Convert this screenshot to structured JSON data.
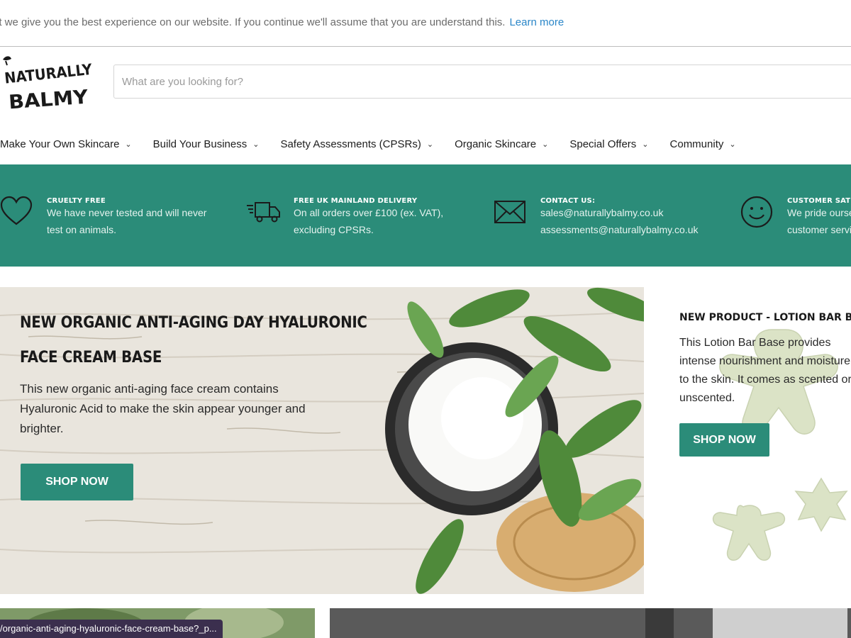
{
  "cookie": {
    "text": "at we give you the best experience on our website. If you continue we'll assume that you are understand this.",
    "link": "Learn more"
  },
  "logo": {
    "line1": "NATURALLY",
    "line2": "BALMY"
  },
  "search": {
    "placeholder": "What are you looking for?"
  },
  "nav": {
    "items": [
      {
        "label": "Make Your Own Skincare"
      },
      {
        "label": "Build Your Business"
      },
      {
        "label": "Safety Assessments (CPSRs)"
      },
      {
        "label": "Organic Skincare"
      },
      {
        "label": "Special Offers"
      },
      {
        "label": "Community"
      }
    ]
  },
  "features": [
    {
      "icon": "heart-icon",
      "title": "CRUELTY FREE",
      "line1": "We have never tested and will never",
      "line2": "test on animals."
    },
    {
      "icon": "truck-icon",
      "title": "FREE UK MAINLAND DELIVERY",
      "line1": "On all orders over £100 (ex. VAT),",
      "line2": "excluding CPSRs."
    },
    {
      "icon": "envelope-icon",
      "title": "CONTACT US:",
      "line1": "sales@naturallybalmy.co.uk",
      "line2": "assessments@naturallybalmy.co.uk"
    },
    {
      "icon": "smiley-icon",
      "title": "CUSTOMER SATISFACTION",
      "line1": "We pride ourselves on our",
      "line2": "customer service"
    }
  ],
  "hero": {
    "title_line1": "NEW ORGANIC ANTI-AGING DAY HYALURONIC",
    "title_line2": "FACE CREAM BASE",
    "desc_line1": "This new organic anti-aging face cream contains",
    "desc_line2": "Hyaluronic Acid to make the skin appear younger and",
    "desc_line3": "brighter.",
    "button": "SHOP NOW"
  },
  "side": {
    "title": "NEW PRODUCT - LOTION BAR BASE",
    "line1": "This Lotion Bar Base provides",
    "line2": "intense nourishment and moisture",
    "line3": "to the skin. It comes as scented or",
    "line4": "unscented.",
    "button": "SHOP NOW"
  },
  "status_url": "/organic-anti-aging-hyaluronic-face-cream-base?_p..."
}
